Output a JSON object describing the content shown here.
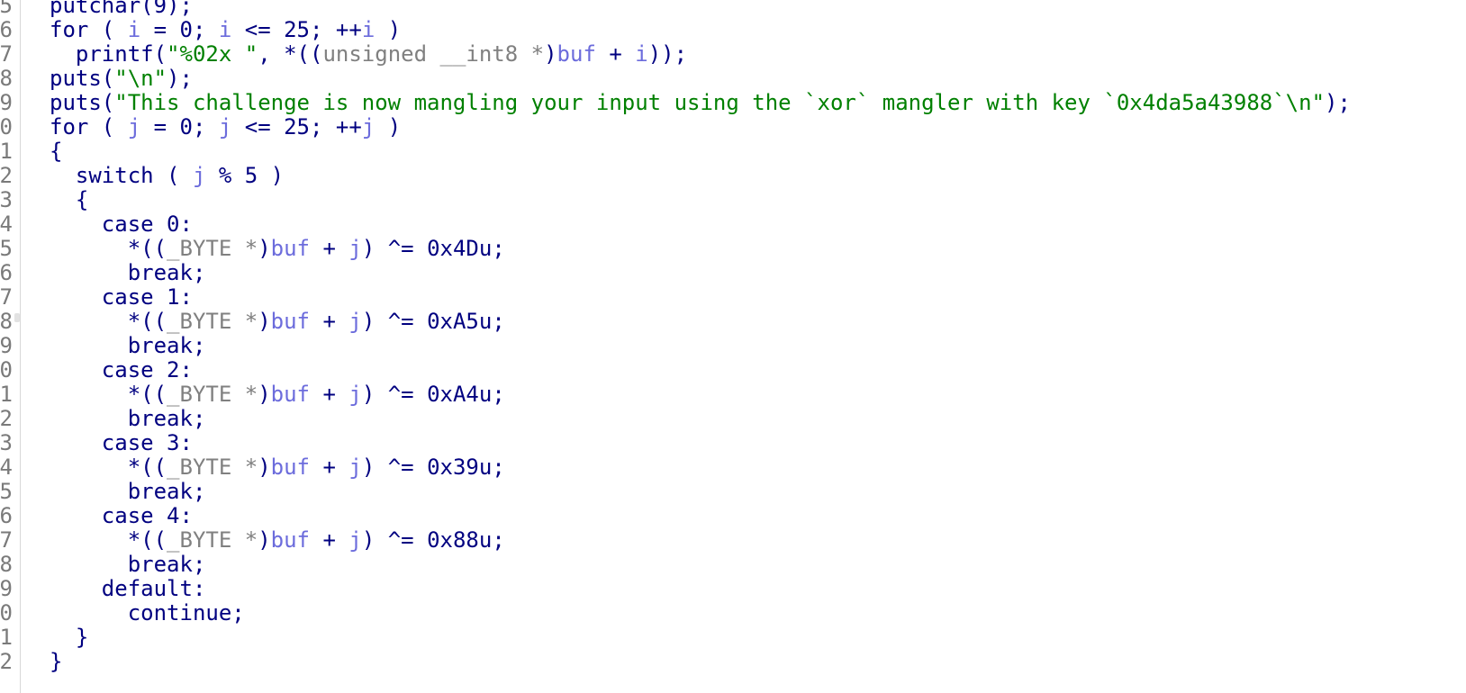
{
  "colors": {
    "keyword": "#000080",
    "variable": "#6c6cdc",
    "string": "#008000",
    "type": "#808080",
    "gutter_text": "#7a7a7a"
  },
  "gutter": {
    "line_numbers": [
      "5",
      "6",
      "7",
      "8",
      "9",
      "0",
      "1",
      "2",
      "3",
      "4",
      "5",
      "6",
      "7",
      "8",
      "9",
      "0",
      "1",
      "2",
      "3",
      "4",
      "5",
      "6",
      "7",
      "8",
      "9",
      "0",
      "1",
      "2"
    ]
  },
  "code": {
    "lines": [
      [
        {
          "t": "putchar(9);",
          "k": "kw"
        }
      ],
      [
        {
          "t": "for ( ",
          "k": "kw"
        },
        {
          "t": "i",
          "k": "var"
        },
        {
          "t": " = 0; ",
          "k": "kw"
        },
        {
          "t": "i",
          "k": "var"
        },
        {
          "t": " <= 25; ++",
          "k": "kw"
        },
        {
          "t": "i",
          "k": "var"
        },
        {
          "t": " )",
          "k": "kw"
        }
      ],
      [
        {
          "t": "  printf(",
          "k": "kw"
        },
        {
          "t": "\"%02x \"",
          "k": "str"
        },
        {
          "t": ", *((",
          "k": "kw"
        },
        {
          "t": "unsigned __int8 *",
          "k": "type"
        },
        {
          "t": ")",
          "k": "kw"
        },
        {
          "t": "buf",
          "k": "var"
        },
        {
          "t": " + ",
          "k": "kw"
        },
        {
          "t": "i",
          "k": "var"
        },
        {
          "t": "));",
          "k": "kw"
        }
      ],
      [
        {
          "t": "puts(",
          "k": "kw"
        },
        {
          "t": "\"\\n\"",
          "k": "str"
        },
        {
          "t": ");",
          "k": "kw"
        }
      ],
      [
        {
          "t": "puts(",
          "k": "kw"
        },
        {
          "t": "\"This challenge is now mangling your input using the `xor` mangler with key `0x4da5a43988`\\n\"",
          "k": "str"
        },
        {
          "t": ");",
          "k": "kw"
        }
      ],
      [
        {
          "t": "for ( ",
          "k": "kw"
        },
        {
          "t": "j",
          "k": "var"
        },
        {
          "t": " = 0; ",
          "k": "kw"
        },
        {
          "t": "j",
          "k": "var"
        },
        {
          "t": " <= 25; ++",
          "k": "kw"
        },
        {
          "t": "j",
          "k": "var"
        },
        {
          "t": " )",
          "k": "kw"
        }
      ],
      [
        {
          "t": "{",
          "k": "kw"
        }
      ],
      [
        {
          "t": "  switch ( ",
          "k": "kw"
        },
        {
          "t": "j",
          "k": "var"
        },
        {
          "t": " % 5 )",
          "k": "kw"
        }
      ],
      [
        {
          "t": "  {",
          "k": "kw"
        }
      ],
      [
        {
          "t": "    case 0:",
          "k": "kw"
        }
      ],
      [
        {
          "t": "      *((",
          "k": "kw"
        },
        {
          "t": "_BYTE *",
          "k": "type"
        },
        {
          "t": ")",
          "k": "kw"
        },
        {
          "t": "buf",
          "k": "var"
        },
        {
          "t": " + ",
          "k": "kw"
        },
        {
          "t": "j",
          "k": "var"
        },
        {
          "t": ") ^= 0x4Du;",
          "k": "kw"
        }
      ],
      [
        {
          "t": "      break;",
          "k": "kw"
        }
      ],
      [
        {
          "t": "    case 1:",
          "k": "kw"
        }
      ],
      [
        {
          "t": "      *((",
          "k": "kw"
        },
        {
          "t": "_BYTE *",
          "k": "type"
        },
        {
          "t": ")",
          "k": "kw"
        },
        {
          "t": "buf",
          "k": "var"
        },
        {
          "t": " + ",
          "k": "kw"
        },
        {
          "t": "j",
          "k": "var"
        },
        {
          "t": ") ^= 0xA5u;",
          "k": "kw"
        }
      ],
      [
        {
          "t": "      break;",
          "k": "kw"
        }
      ],
      [
        {
          "t": "    case 2:",
          "k": "kw"
        }
      ],
      [
        {
          "t": "      *((",
          "k": "kw"
        },
        {
          "t": "_BYTE *",
          "k": "type"
        },
        {
          "t": ")",
          "k": "kw"
        },
        {
          "t": "buf",
          "k": "var"
        },
        {
          "t": " + ",
          "k": "kw"
        },
        {
          "t": "j",
          "k": "var"
        },
        {
          "t": ") ^= 0xA4u;",
          "k": "kw"
        }
      ],
      [
        {
          "t": "      break;",
          "k": "kw"
        }
      ],
      [
        {
          "t": "    case 3:",
          "k": "kw"
        }
      ],
      [
        {
          "t": "      *((",
          "k": "kw"
        },
        {
          "t": "_BYTE *",
          "k": "type"
        },
        {
          "t": ")",
          "k": "kw"
        },
        {
          "t": "buf",
          "k": "var"
        },
        {
          "t": " + ",
          "k": "kw"
        },
        {
          "t": "j",
          "k": "var"
        },
        {
          "t": ") ^= 0x39u;",
          "k": "kw"
        }
      ],
      [
        {
          "t": "      break;",
          "k": "kw"
        }
      ],
      [
        {
          "t": "    case 4:",
          "k": "kw"
        }
      ],
      [
        {
          "t": "      *((",
          "k": "kw"
        },
        {
          "t": "_BYTE *",
          "k": "type"
        },
        {
          "t": ")",
          "k": "kw"
        },
        {
          "t": "buf",
          "k": "var"
        },
        {
          "t": " + ",
          "k": "kw"
        },
        {
          "t": "j",
          "k": "var"
        },
        {
          "t": ") ^= 0x88u;",
          "k": "kw"
        }
      ],
      [
        {
          "t": "      break;",
          "k": "kw"
        }
      ],
      [
        {
          "t": "    default:",
          "k": "kw"
        }
      ],
      [
        {
          "t": "      continue;",
          "k": "kw"
        }
      ],
      [
        {
          "t": "  }",
          "k": "kw"
        }
      ],
      [
        {
          "t": "}",
          "k": "kw"
        }
      ]
    ]
  }
}
